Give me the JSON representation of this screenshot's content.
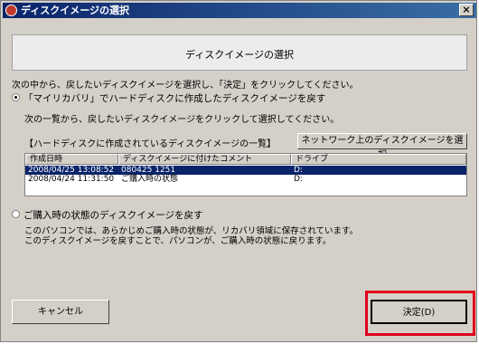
{
  "window": {
    "title": "ディスクイメージの選択",
    "close_glyph": "×"
  },
  "header": {
    "title": "ディスクイメージの選択"
  },
  "instruction": "次の中から、戻したいディスクイメージを選択し、「決定」をクリックしてください。",
  "option_myrecovery": {
    "label": "「マイリカバリ」でハードディスクに作成したディスクイメージを戻す",
    "sub_text": "次の一覧から、戻したいディスクイメージをクリックして選択してください。",
    "list_title": "【ハードディスクに作成されているディスクイメージの一覧】",
    "network_button": "ネットワーク上のディスクイメージを選択",
    "columns": [
      "作成日時",
      "ディスクイメージに付けたコメント",
      "ドライブ"
    ],
    "rows": [
      {
        "date": "2008/04/25 13:08:52",
        "comment": "080425 1251",
        "drive": "D:",
        "selected": true
      },
      {
        "date": "2008/04/24 11:31:50",
        "comment": "ご購入時の状態",
        "drive": "D:",
        "selected": false
      }
    ]
  },
  "option_factory": {
    "label": "ご購入時の状態のディスクイメージを戻す",
    "desc_line1": "このパソコンでは、あらかじめご購入時の状態が、リカバリ領域に保存されています。",
    "desc_line2": "このディスクイメージを戻すことで、パソコンが、ご購入時の状態に戻ります。"
  },
  "footer": {
    "cancel": "キャンセル",
    "ok": "決定(D)"
  },
  "colors": {
    "highlight": "#e0001a",
    "selection": "#0a246a",
    "titlebar": "#0a246a"
  }
}
